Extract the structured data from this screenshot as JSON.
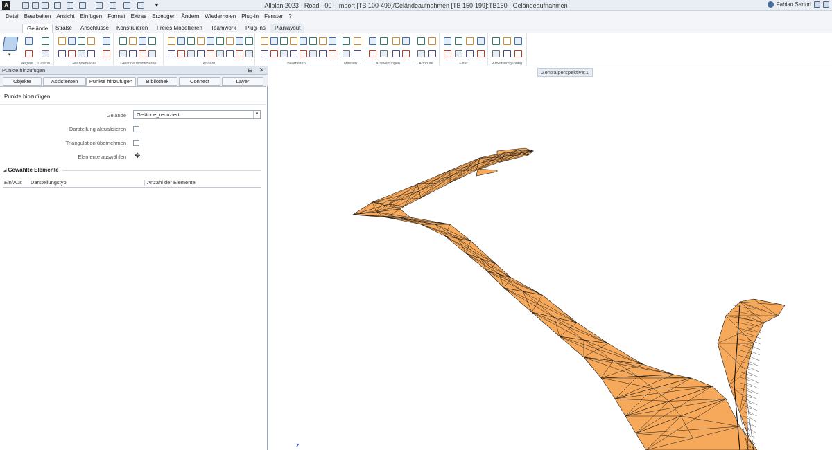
{
  "app": {
    "logo": "A",
    "title": "Allplan 2023 - Road - 00 - Import [TB 100-499]/Geländeaufnahmen [TB 150-199]:TB150 - Geländeaufnahmen",
    "user": "Fabian Sartori"
  },
  "menu": [
    "Datei",
    "Bearbeiten",
    "Ansicht",
    "Einfügen",
    "Format",
    "Extras",
    "Erzeugen",
    "Ändern",
    "Wiederholen",
    "Plug-in",
    "Fenster",
    "?"
  ],
  "ribbon_tabs": [
    {
      "label": "Gelände",
      "active": true
    },
    {
      "label": "Straße",
      "active": false
    },
    {
      "label": "Anschlüsse",
      "active": false
    },
    {
      "label": "Konstruieren",
      "active": false
    },
    {
      "label": "Freies Modellieren",
      "active": false
    },
    {
      "label": "Teamwork",
      "active": false
    },
    {
      "label": "Plug-ins",
      "active": false
    },
    {
      "label": "Planlayout",
      "active": false
    }
  ],
  "ribbon_groups": [
    "Allgem...",
    "Datenü...",
    "Geländemodell",
    "Gelände modifizieren",
    "Ändern",
    "Bearbeiten",
    "Massen",
    "Auswertungen",
    "Attribute",
    "Filter",
    "Arbeitsumgebung"
  ],
  "ribbon_dropdown": "▾",
  "panel": {
    "title": "Punkte hinzufügen",
    "pin": "⊞",
    "close": "✕",
    "tabs": [
      {
        "label": "Objekte",
        "active": false
      },
      {
        "label": "Assistenten",
        "active": false
      },
      {
        "label": "Punkte hinzufügen",
        "active": true
      },
      {
        "label": "Bibliothek",
        "active": false
      },
      {
        "label": "Connect",
        "active": false
      },
      {
        "label": "Layer",
        "active": false
      }
    ],
    "section_title": "Punkte hinzufügen",
    "terrain_label": "Gelände",
    "terrain_value": "Gelände_reduziert",
    "terrain_arrow": "▼",
    "update_label": "Darstellung aktualisieren",
    "update_checked": false,
    "triangulation_label": "Triangulation übernehmen",
    "triangulation_checked": false,
    "select_label": "Elemente auswählen",
    "select_icon": "✥",
    "selected_header": "Gewählte Elemente",
    "columns": [
      "Ein/Aus",
      "Darstellungstyp",
      "Anzahl der Elemente"
    ]
  },
  "viewport": {
    "view_label": "Zentralperspektive:1",
    "axis_label": "z",
    "terrain_color": "#f6a95a",
    "mesh_color": "#1a1a1a"
  }
}
